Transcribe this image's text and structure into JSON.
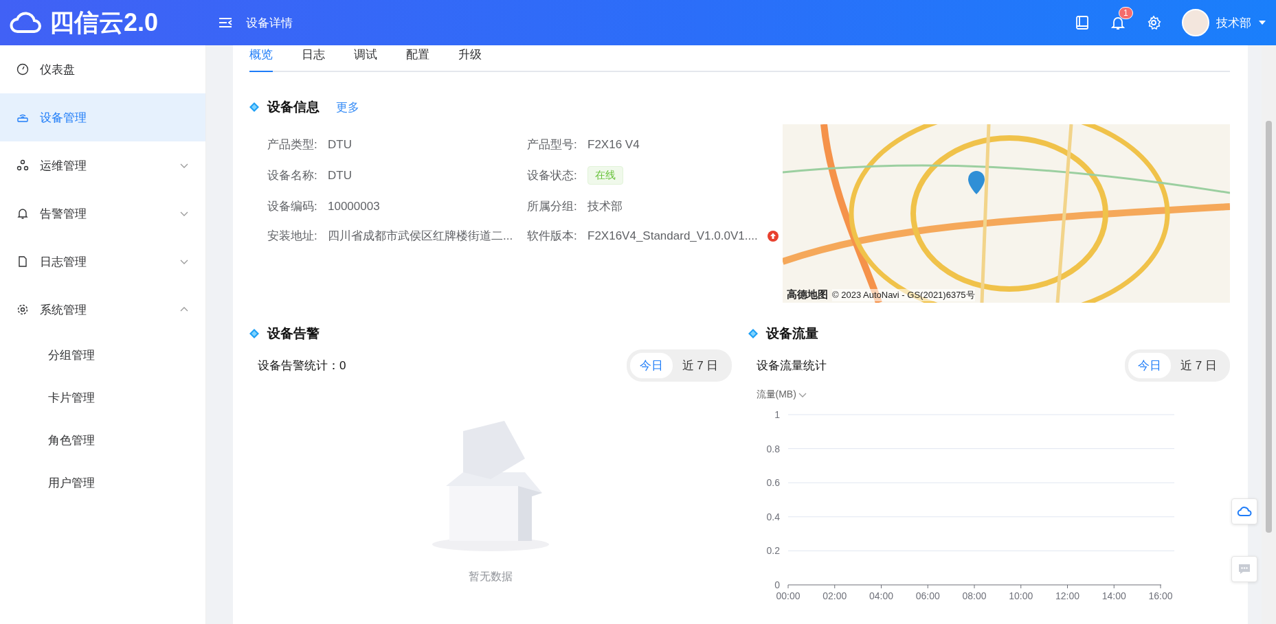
{
  "header": {
    "logo_text": "四信云2.0",
    "page_title": "设备详情",
    "notification_count": "1",
    "user_name": "技术部"
  },
  "sidebar": {
    "items": [
      {
        "label": "仪表盘",
        "selected": false
      },
      {
        "label": "设备管理",
        "selected": true
      },
      {
        "label": "运维管理",
        "selected": false,
        "expanded": false
      },
      {
        "label": "告警管理",
        "selected": false,
        "expanded": false
      },
      {
        "label": "日志管理",
        "selected": false,
        "expanded": false
      },
      {
        "label": "系统管理",
        "selected": false,
        "expanded": true,
        "children": [
          {
            "label": "分组管理",
            "selected": false
          },
          {
            "label": "卡片管理",
            "selected": false
          },
          {
            "label": "角色管理",
            "selected": false
          },
          {
            "label": "用户管理",
            "selected": false
          }
        ]
      }
    ]
  },
  "tabs": [
    {
      "label": "概览",
      "selected": true
    },
    {
      "label": "日志",
      "selected": false
    },
    {
      "label": "调试",
      "selected": false
    },
    {
      "label": "配置",
      "selected": false
    },
    {
      "label": "升级",
      "selected": false
    }
  ],
  "device_info": {
    "title": "设备信息",
    "more_link": "更多",
    "fields": [
      {
        "label": "产品类型:",
        "value": "DTU",
        "kind": "text"
      },
      {
        "label": "产品型号:",
        "value": "F2X16 V4",
        "kind": "text"
      },
      {
        "label": "设备名称:",
        "value": "DTU",
        "kind": "text"
      },
      {
        "label": "设备状态:",
        "value": "在线",
        "kind": "badge"
      },
      {
        "label": "设备编码:",
        "value": "10000003",
        "kind": "text"
      },
      {
        "label": "所属分组:",
        "value": "技术部",
        "kind": "text"
      },
      {
        "label": "安装地址:",
        "value": "四川省成都市武侯区红牌楼街道二...",
        "kind": "text"
      },
      {
        "label": "软件版本:",
        "value": "F2X16V4_Standard_V1.0.0V1....",
        "kind": "upgradable"
      }
    ]
  },
  "map": {
    "logo": "高德地图",
    "attribution": "© 2023 AutoNavi - GS(2021)6375号"
  },
  "alarms": {
    "title": "设备告警",
    "stat_label": "设备告警统计：0",
    "range_options": [
      {
        "label": "今日",
        "selected": true
      },
      {
        "label": "近 7 日",
        "selected": false
      }
    ],
    "empty_text": "暂无数据"
  },
  "traffic": {
    "title": "设备流量",
    "stat_label": "设备流量统计",
    "range_options": [
      {
        "label": "今日",
        "selected": true
      },
      {
        "label": "近 7 日",
        "selected": false
      }
    ],
    "chart_data": {
      "type": "line",
      "ylabel": "流量(MB)",
      "categories": [
        "00:00",
        "02:00",
        "04:00",
        "06:00",
        "08:00",
        "10:00",
        "12:00",
        "14:00",
        "16:00"
      ],
      "ylim": [
        0,
        1
      ],
      "grid": true,
      "yticks": [
        0,
        0.2,
        0.4,
        0.6,
        0.8,
        1
      ]
    }
  }
}
